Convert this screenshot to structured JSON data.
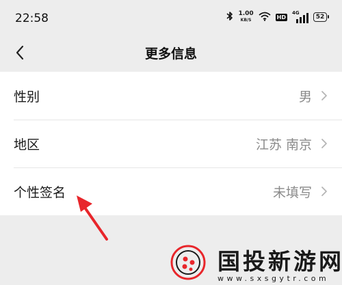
{
  "status_bar": {
    "time": "22:58",
    "speed_value": "1.00",
    "speed_unit": "KB/S",
    "hd_label": "HD",
    "network_label": "4G",
    "battery_level": "52"
  },
  "header": {
    "title": "更多信息"
  },
  "rows": [
    {
      "label": "性别",
      "value": "男"
    },
    {
      "label": "地区",
      "value": "江苏 南京"
    },
    {
      "label": "个性签名",
      "value": "未填写"
    }
  ],
  "annotation": {
    "arrow_color": "#e8262b"
  },
  "watermark": {
    "title": "国投新游网",
    "url": "www.sxsgytr.com"
  },
  "colors": {
    "background": "#ededed",
    "row_background": "#ffffff",
    "value_text": "#8a8a8a",
    "accent_red": "#e8262b"
  }
}
